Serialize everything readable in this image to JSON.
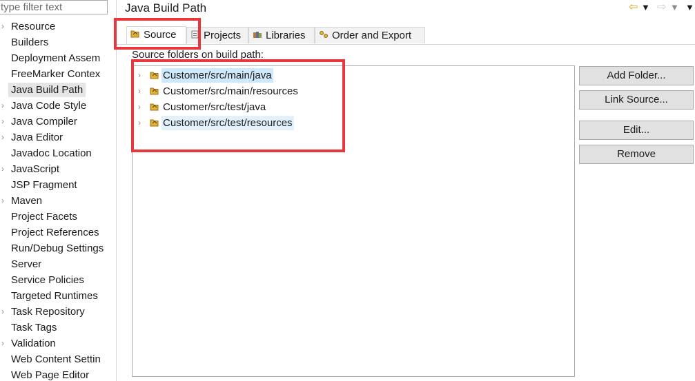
{
  "sidebar": {
    "filter_placeholder": "type filter text",
    "items": [
      {
        "label": "Resource",
        "expandable": true
      },
      {
        "label": "Builders",
        "expandable": false
      },
      {
        "label": "Deployment Assem",
        "expandable": false
      },
      {
        "label": "FreeMarker Contex",
        "expandable": false
      },
      {
        "label": "Java Build Path",
        "expandable": false,
        "selected": true
      },
      {
        "label": "Java Code Style",
        "expandable": true
      },
      {
        "label": "Java Compiler",
        "expandable": true
      },
      {
        "label": "Java Editor",
        "expandable": true
      },
      {
        "label": "Javadoc Location",
        "expandable": false
      },
      {
        "label": "JavaScript",
        "expandable": true
      },
      {
        "label": "JSP Fragment",
        "expandable": false
      },
      {
        "label": "Maven",
        "expandable": true
      },
      {
        "label": "Project Facets",
        "expandable": false
      },
      {
        "label": "Project References",
        "expandable": false
      },
      {
        "label": "Run/Debug Settings",
        "expandable": false
      },
      {
        "label": "Server",
        "expandable": false
      },
      {
        "label": "Service Policies",
        "expandable": false
      },
      {
        "label": "Targeted Runtimes",
        "expandable": false
      },
      {
        "label": "Task Repository",
        "expandable": true
      },
      {
        "label": "Task Tags",
        "expandable": false
      },
      {
        "label": "Validation",
        "expandable": true
      },
      {
        "label": "Web Content Settin",
        "expandable": false
      },
      {
        "label": "Web Page Editor",
        "expandable": false
      }
    ]
  },
  "header": {
    "title": "Java Build Path"
  },
  "tabs": [
    {
      "label": "Source",
      "icon": "source-folder-icon",
      "active": true
    },
    {
      "label": "Projects",
      "icon": "projects-icon",
      "active": false
    },
    {
      "label": "Libraries",
      "icon": "libraries-icon",
      "active": false
    },
    {
      "label": "Order and Export",
      "icon": "order-export-icon",
      "active": false
    }
  ],
  "source": {
    "label": "Source folders on build path:",
    "folders": [
      "Customer/src/main/java",
      "Customer/src/main/resources",
      "Customer/src/test/java",
      "Customer/src/test/resources"
    ]
  },
  "buttons": {
    "add_folder": "Add Folder...",
    "link_source": "Link Source...",
    "edit": "Edit...",
    "remove": "Remove"
  },
  "colors": {
    "annotation": "#e8373c",
    "selection": "#cfe8fb",
    "folder_icon": "#e0b23c"
  }
}
